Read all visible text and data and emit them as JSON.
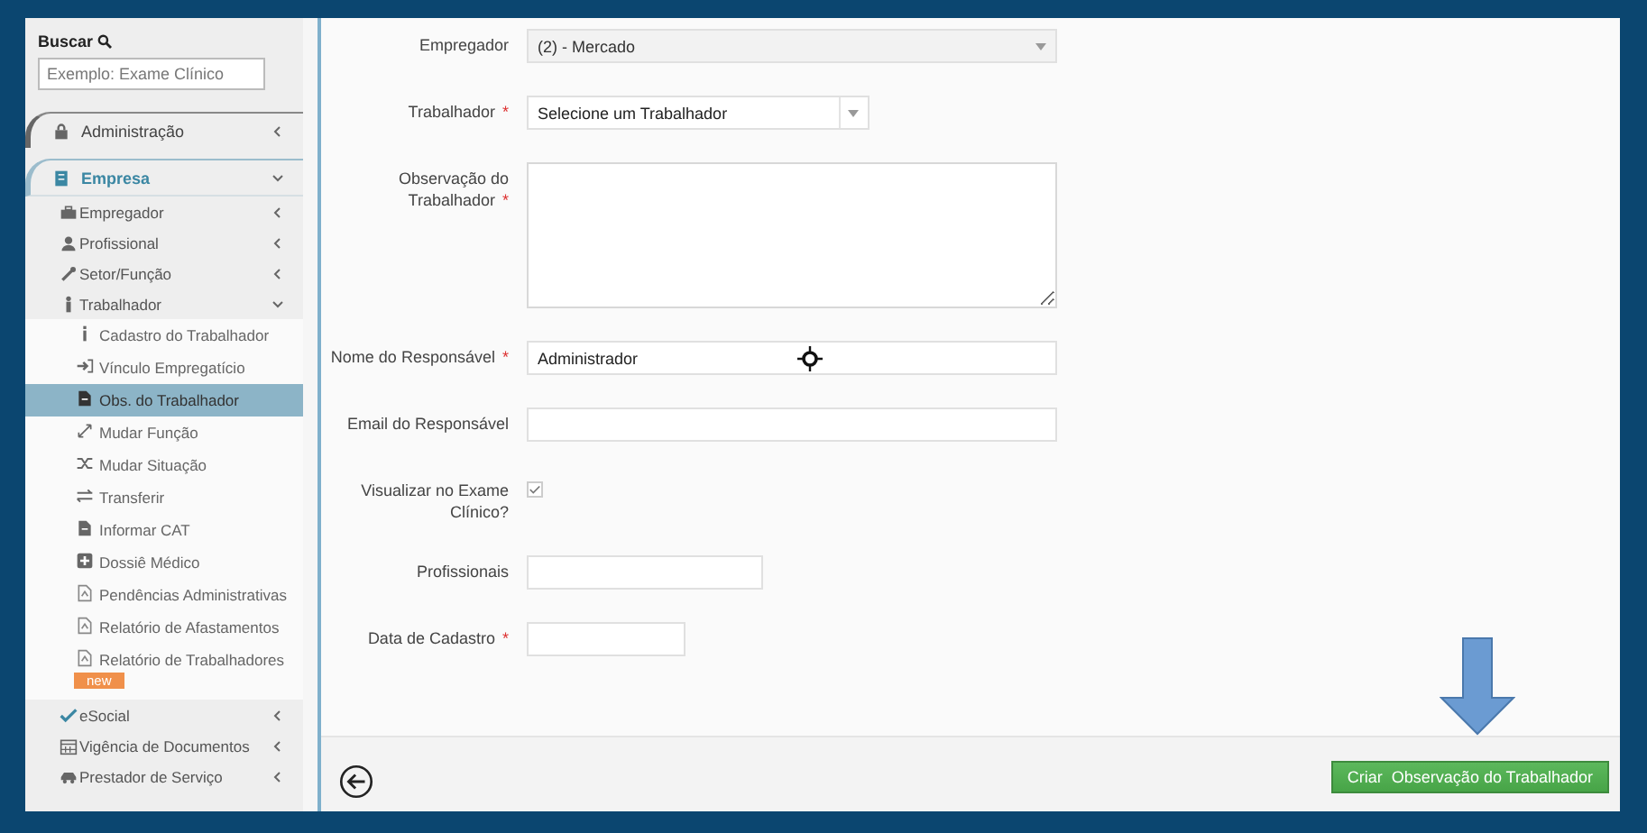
{
  "sidebar": {
    "search_label": "Buscar",
    "search_placeholder": "Exemplo: Exame Clínico",
    "menu": [
      {
        "label": "Administração",
        "expanded": false
      },
      {
        "label": "Empresa",
        "expanded": true,
        "children": [
          {
            "label": "Empregador",
            "expanded": false
          },
          {
            "label": "Profissional",
            "expanded": false
          },
          {
            "label": "Setor/Função",
            "expanded": false
          },
          {
            "label": "Trabalhador",
            "expanded": true,
            "children": [
              {
                "label": "Cadastro do Trabalhador",
                "selected": false
              },
              {
                "label": "Vínculo Empregatício",
                "selected": false
              },
              {
                "label": "Obs. do Trabalhador",
                "selected": true
              },
              {
                "label": "Mudar Função",
                "selected": false
              },
              {
                "label": "Mudar Situação",
                "selected": false
              },
              {
                "label": "Transferir",
                "selected": false
              },
              {
                "label": "Informar CAT",
                "selected": false
              },
              {
                "label": "Dossiê Médico",
                "selected": false
              },
              {
                "label": "Pendências Administrativas",
                "selected": false
              },
              {
                "label": "Relatório de Afastamentos",
                "selected": false
              },
              {
                "label": "Relatório de Trabalhadores",
                "selected": false,
                "badge": "new"
              }
            ]
          },
          {
            "label": "eSocial",
            "expanded": false
          },
          {
            "label": "Vigência de Documentos",
            "expanded": false
          },
          {
            "label": "Prestador de Serviço",
            "expanded": false
          }
        ]
      }
    ]
  },
  "form": {
    "fields": [
      {
        "kind": "select",
        "label": "Empregador",
        "value": "(2) - Mercado",
        "disabled": true
      },
      {
        "kind": "combobox",
        "label": "Trabalhador",
        "required_mark": "*",
        "value": "Selecione um Trabalhador"
      },
      {
        "kind": "textarea",
        "label": "Observação do Trabalhador",
        "required_mark": "*"
      },
      {
        "kind": "text",
        "label": "Nome do Responsável",
        "required_mark": "*",
        "value": "Administrador"
      },
      {
        "kind": "text",
        "label": "Email do Responsável"
      },
      {
        "kind": "checkbox",
        "label": "Visualizar no Exame Clínico?",
        "checked": true
      },
      {
        "kind": "multiselect",
        "label": "Profissionais"
      },
      {
        "kind": "date",
        "label": "Data de Cadastro",
        "required_mark": "*"
      }
    ]
  },
  "footer": {
    "submit_button": "Criar  Observação do Trabalhador"
  }
}
